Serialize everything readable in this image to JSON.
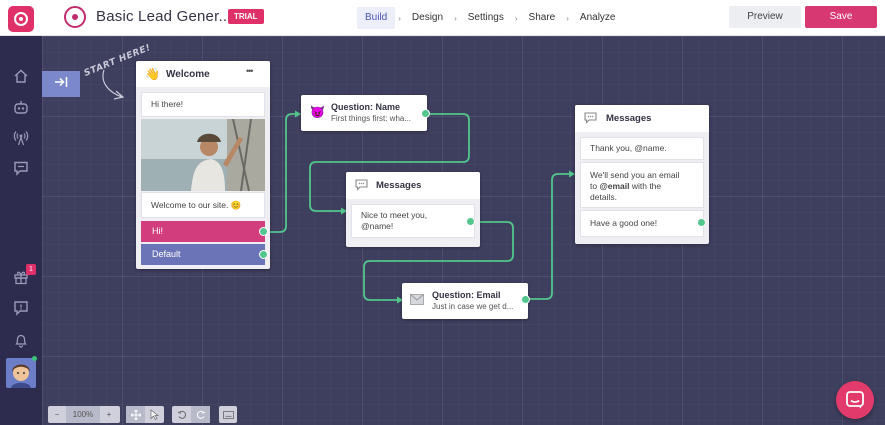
{
  "app": {
    "bot_title": "Basic Lead Gener...",
    "trial_badge": "TRIAL"
  },
  "nav": [
    {
      "label": "Build",
      "active": true
    },
    {
      "label": "Design"
    },
    {
      "label": "Settings"
    },
    {
      "label": "Share"
    },
    {
      "label": "Analyze"
    }
  ],
  "nav_separator": "›",
  "toolbar": {
    "preview_label": "Preview",
    "save_label": "Save"
  },
  "sidebar": {
    "gift_badge": "1",
    "icons": [
      "home-icon",
      "bot-icon",
      "broadcast-icon",
      "chat-icon",
      "gift-icon",
      "feedback-icon",
      "bell-icon",
      "help-icon"
    ]
  },
  "canvas": {
    "start_hint": "START HERE!"
  },
  "nodes": {
    "welcome": {
      "title": "Welcome",
      "menu": "•••",
      "emoji": "👋",
      "greeting": "Hi there!",
      "caption": "Welcome to our site. 😊",
      "options": [
        "Hi!",
        "Default"
      ]
    },
    "question_name": {
      "emoji": "😈",
      "title": "Question: Name",
      "subtitle": "First things first: wha..."
    },
    "messages_1": {
      "title": "Messages",
      "text_1": "Nice to meet you,",
      "text_2": "@name!"
    },
    "question_email": {
      "title": "Question: Email",
      "subtitle": "Just in case we get d..."
    },
    "messages_2": {
      "title": "Messages",
      "m1": "Thank you, @name.",
      "m2_a": "We'll send you an email",
      "m2_b_pre": "to ",
      "m2_b_bold": "@email",
      "m2_b_post": " with the",
      "m2_c": "details.",
      "m3": "Have a good one!"
    }
  },
  "zoom": {
    "minus": "−",
    "value": "100%",
    "plus": "+"
  },
  "colors": {
    "accent": "#d83872",
    "link": "#52c68c",
    "option_pink": "#d23d7d",
    "option_blue": "#6c74b8"
  }
}
